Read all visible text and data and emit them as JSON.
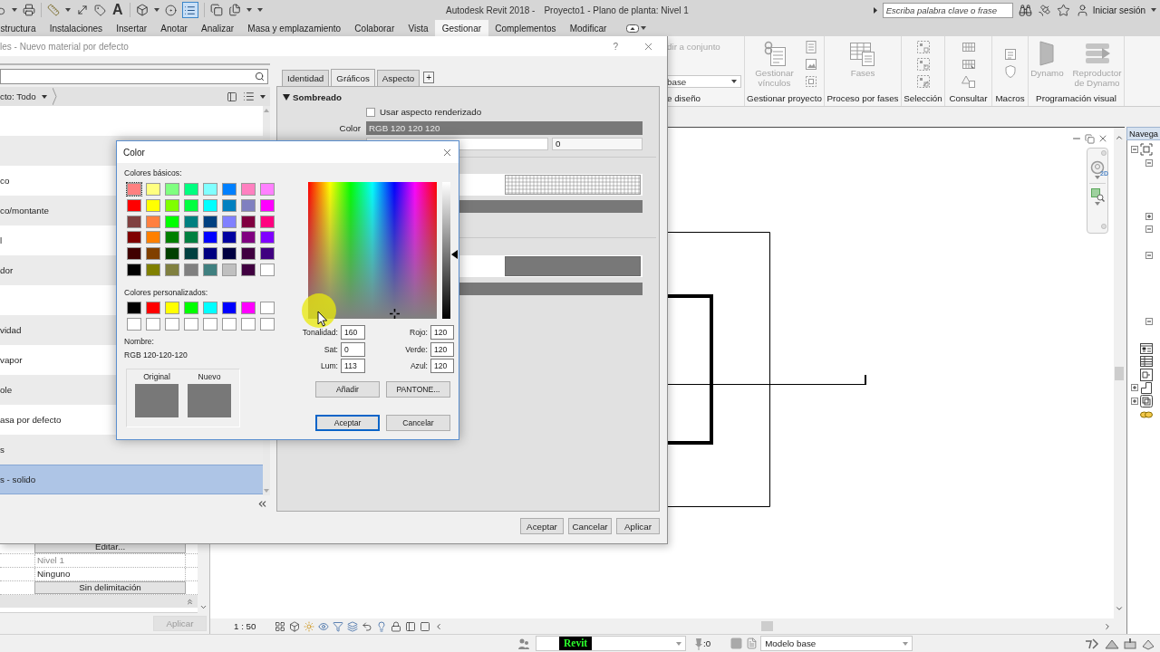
{
  "title_bar": {
    "quick_access": {
      "thin_lines_on": true,
      "text_glyph": "A"
    },
    "app_title": "Autodesk Revit 2018 -",
    "document_title": "Proyecto1 - Plano de planta: Nivel 1",
    "search": {
      "placeholder": "Escriba palabra clave o frase"
    },
    "sign_in": "Iniciar sesión"
  },
  "ribbon_tabs": [
    {
      "label": "structura",
      "selected": false
    },
    {
      "label": "Instalaciones",
      "selected": false
    },
    {
      "label": "Insertar",
      "selected": false
    },
    {
      "label": "Anotar",
      "selected": false
    },
    {
      "label": "Analizar",
      "selected": false
    },
    {
      "label": "Masa y emplazamiento",
      "selected": false
    },
    {
      "label": "Colaborar",
      "selected": false
    },
    {
      "label": "Vista",
      "selected": false
    },
    {
      "label": "Gestionar",
      "selected": true
    },
    {
      "label": "Complementos",
      "selected": false
    },
    {
      "label": "Modificar",
      "selected": false
    }
  ],
  "ribbon": {
    "cut_panel": {
      "button": {
        "label": "dir a conjunto",
        "disabled": true
      },
      "dropdown": "base",
      "title": "e diseño"
    },
    "panels": [
      {
        "kind": "links",
        "title": "Gestionar proyecto",
        "buttons": [
          {
            "label": "Gestionar vínculos",
            "disabled": true
          }
        ]
      },
      {
        "kind": "phases",
        "title": "Proceso por fases",
        "buttons": [
          {
            "label": "Fases",
            "disabled": true
          }
        ]
      },
      {
        "kind": "selection",
        "title": "Selección"
      },
      {
        "kind": "inquiry",
        "title": "Consultar"
      },
      {
        "kind": "macros",
        "title": "Macros"
      },
      {
        "kind": "dynamo",
        "title": "Programación visual",
        "buttons": [
          {
            "label": "Dynamo",
            "disabled": true
          },
          {
            "label": "Reproductor de Dynamo",
            "disabled": true
          }
        ]
      }
    ]
  },
  "properties": {
    "rows": [
      {
        "kind": "button",
        "value": "Editar...",
        "disabled": false
      },
      {
        "kind": "text",
        "value": "Nivel 1",
        "disabled": true
      },
      {
        "kind": "text",
        "value": "Ninguno",
        "disabled": false
      },
      {
        "kind": "button",
        "value": "Sin delimitación",
        "disabled": false
      }
    ],
    "apply": {
      "label": "Aplicar",
      "disabled": true
    }
  },
  "view": {
    "scale": "1 : 50",
    "navigation_bar": {
      "wheel_label": "2D"
    }
  },
  "project_browser": {
    "title": "Navega",
    "nodes": [
      {
        "kind": "views",
        "expanded": true,
        "children": [
          {
            "expanded": true
          },
          {
            "expanded": false
          },
          {
            "expanded": true
          },
          {
            "expanded": true
          },
          {
            "expanded": true
          }
        ]
      },
      {
        "kind": "legends"
      },
      {
        "kind": "schedules"
      },
      {
        "kind": "sheets"
      },
      {
        "kind": "families",
        "expanded": false
      },
      {
        "kind": "groups",
        "expanded": false
      },
      {
        "kind": "links"
      }
    ]
  },
  "status_bar": {
    "badge": "Revit",
    "selection_count": ":0",
    "model": "Modelo base"
  },
  "material_browser": {
    "title": "les - Nuevo material por defecto",
    "help_glyph": "?",
    "filter": "cto: Todo",
    "materials": [
      {
        "selected": false
      },
      {
        "selected": false
      },
      {
        "name": "co",
        "selected": false
      },
      {
        "name": "co/montante",
        "selected": false
      },
      {
        "name": "l",
        "selected": false
      },
      {
        "name": "dor",
        "selected": false
      },
      {
        "selected": false
      },
      {
        "name": "vidad",
        "selected": false
      },
      {
        "name": "vapor",
        "selected": false
      },
      {
        "name": "ole",
        "selected": false
      },
      {
        "name": "asa por defecto",
        "selected": false
      },
      {
        "name": "s",
        "selected": false
      },
      {
        "name": "s - solido",
        "selected": true
      }
    ],
    "tabs": [
      {
        "label": "Identidad",
        "selected": false
      },
      {
        "label": "Gráficos",
        "selected": true
      },
      {
        "label": "Aspecto",
        "selected": false
      }
    ],
    "add_tab": "+",
    "section": {
      "title": "Sombreado",
      "expanded": true
    },
    "use_render_appearance": {
      "label": "Usar aspecto renderizado",
      "checked": false
    },
    "color": {
      "label": "Color",
      "value": "RGB 120 120 120"
    },
    "transparency": {
      "value": "0"
    },
    "buttons": [
      {
        "label": "Aceptar"
      },
      {
        "label": "Cancelar"
      },
      {
        "label": "Aplicar"
      }
    ]
  },
  "color_dialog": {
    "title": "Color",
    "basic_label": "Colores básicos:",
    "basic_colors": [
      {
        "color": "#ff8080",
        "selected": true
      },
      {
        "color": "#ffff80",
        "selected": false
      },
      {
        "color": "#80ff80",
        "selected": false
      },
      {
        "color": "#00ff80",
        "selected": false
      },
      {
        "color": "#80ffff",
        "selected": false
      },
      {
        "color": "#0080ff",
        "selected": false
      },
      {
        "color": "#ff80c0",
        "selected": false
      },
      {
        "color": "#ff80ff",
        "selected": false
      },
      {
        "color": "#ff0000",
        "selected": false
      },
      {
        "color": "#ffff00",
        "selected": false
      },
      {
        "color": "#80ff00",
        "selected": false
      },
      {
        "color": "#00ff40",
        "selected": false
      },
      {
        "color": "#00ffff",
        "selected": false
      },
      {
        "color": "#0080c0",
        "selected": false
      },
      {
        "color": "#8080c0",
        "selected": false
      },
      {
        "color": "#ff00ff",
        "selected": false
      },
      {
        "color": "#804040",
        "selected": false
      },
      {
        "color": "#ff8040",
        "selected": false
      },
      {
        "color": "#00ff00",
        "selected": false
      },
      {
        "color": "#008080",
        "selected": false
      },
      {
        "color": "#004080",
        "selected": false
      },
      {
        "color": "#8080ff",
        "selected": false
      },
      {
        "color": "#800040",
        "selected": false
      },
      {
        "color": "#ff0080",
        "selected": false
      },
      {
        "color": "#800000",
        "selected": false
      },
      {
        "color": "#ff8000",
        "selected": false
      },
      {
        "color": "#008000",
        "selected": false
      },
      {
        "color": "#008040",
        "selected": false
      },
      {
        "color": "#0000ff",
        "selected": false
      },
      {
        "color": "#0000a0",
        "selected": false
      },
      {
        "color": "#800080",
        "selected": false
      },
      {
        "color": "#8000ff",
        "selected": false
      },
      {
        "color": "#400000",
        "selected": false
      },
      {
        "color": "#804000",
        "selected": false
      },
      {
        "color": "#004000",
        "selected": false
      },
      {
        "color": "#004040",
        "selected": false
      },
      {
        "color": "#000080",
        "selected": false
      },
      {
        "color": "#000040",
        "selected": false
      },
      {
        "color": "#400040",
        "selected": false
      },
      {
        "color": "#400080",
        "selected": false
      },
      {
        "color": "#000000",
        "selected": false
      },
      {
        "color": "#808000",
        "selected": false
      },
      {
        "color": "#808040",
        "selected": false
      },
      {
        "color": "#808080",
        "selected": false
      },
      {
        "color": "#408080",
        "selected": false
      },
      {
        "color": "#c0c0c0",
        "selected": false
      },
      {
        "color": "#400040",
        "selected": false
      },
      {
        "color": "#ffffff",
        "selected": false
      }
    ],
    "custom_label": "Colores personalizados:",
    "custom_colors": [
      {
        "color": "#000000",
        "selected": false
      },
      {
        "color": "#ff0000",
        "selected": false
      },
      {
        "color": "#ffff00",
        "selected": false
      },
      {
        "color": "#00ff00",
        "selected": false
      },
      {
        "color": "#00ffff",
        "selected": false
      },
      {
        "color": "#0000ff",
        "selected": false
      },
      {
        "color": "#ff00ff",
        "selected": false
      },
      {
        "color": "#ffffff",
        "selected": false
      },
      {
        "color": "#ffffff",
        "selected": false
      },
      {
        "color": "#ffffff",
        "selected": false
      },
      {
        "color": "#ffffff",
        "selected": false
      },
      {
        "color": "#ffffff",
        "selected": false
      },
      {
        "color": "#ffffff",
        "selected": false
      },
      {
        "color": "#ffffff",
        "selected": false
      },
      {
        "color": "#ffffff",
        "selected": false
      },
      {
        "color": "#ffffff",
        "selected": false
      }
    ],
    "name_label": "Nombre:",
    "name_value": "RGB 120-120-120",
    "preview": {
      "original_label": "Original",
      "new_label": "Nuevo"
    },
    "luminance": {
      "level": 0.47
    },
    "fields": [
      {
        "label": "Tonalidad:",
        "value": "160"
      },
      {
        "label": "Sat:",
        "value": "0"
      },
      {
        "label": "Lum:",
        "value": "113"
      },
      {
        "label": "Rojo:",
        "value": "120"
      },
      {
        "label": "Verde:",
        "value": "120"
      },
      {
        "label": "Azul:",
        "value": "120"
      }
    ],
    "buttons": [
      {
        "label": "Añadir",
        "default": false
      },
      {
        "label": "PANTONE...",
        "default": false
      },
      {
        "label": "Aceptar",
        "default": true
      },
      {
        "label": "Cancelar",
        "default": false
      }
    ]
  }
}
